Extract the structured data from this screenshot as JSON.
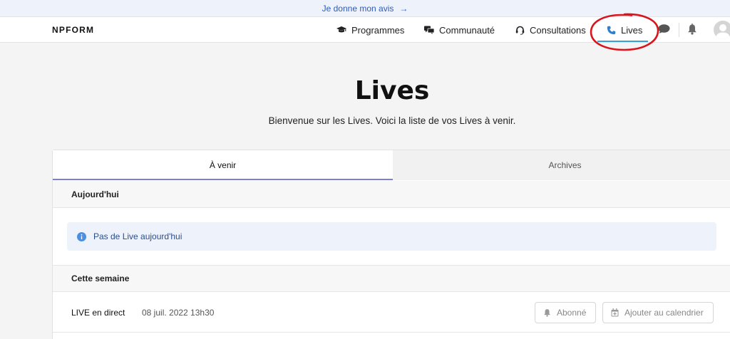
{
  "feedback": {
    "label": "Je donne mon avis",
    "arrow": "→"
  },
  "navbar": {
    "logo": "NPFORM",
    "items": [
      {
        "label": "Programmes",
        "icon": "graduation-cap-icon"
      },
      {
        "label": "Communauté",
        "icon": "chat-bubbles-icon"
      },
      {
        "label": "Consultations",
        "icon": "headset-icon"
      },
      {
        "label": "Lives",
        "icon": "phone-icon",
        "active": true
      }
    ],
    "icons": [
      "chat-icon",
      "bell-icon",
      "avatar"
    ]
  },
  "page": {
    "title": "Lives",
    "subtitle": "Bienvenue sur les Lives. Voici la liste de vos Lives à venir."
  },
  "tabs": [
    {
      "label": "À venir",
      "active": true
    },
    {
      "label": "Archives",
      "active": false
    }
  ],
  "sections": {
    "today": {
      "title": "Aujourd'hui",
      "empty_message": "Pas de Live aujourd'hui"
    },
    "week": {
      "title": "Cette semaine",
      "lives": [
        {
          "name": "LIVE en direct",
          "date": "08 juil. 2022 13h30",
          "subscribe_label": "Abonné",
          "calendar_label": "Ajouter au calendrier"
        }
      ]
    }
  },
  "colors": {
    "accent_blue": "#3aa0d8",
    "tab_underline": "#7b7fd6",
    "link_blue": "#2f5bb7",
    "annotation_red": "#d9141b"
  }
}
